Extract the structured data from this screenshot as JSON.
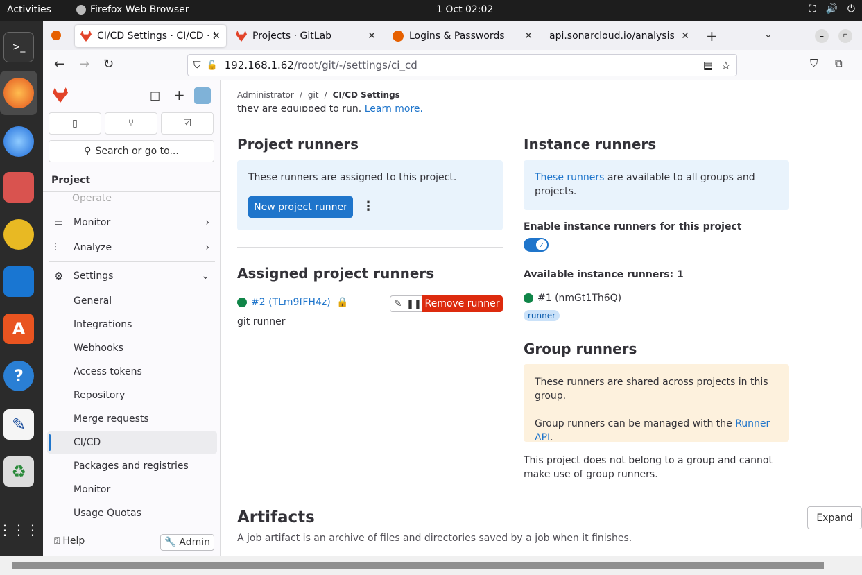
{
  "topbar": {
    "activities": "Activities",
    "app": "Firefox Web Browser",
    "clock": "1 Oct  02:02"
  },
  "tabs": [
    {
      "label": "CI/CD Settings · CI/CD · Se"
    },
    {
      "label": "Projects · GitLab"
    },
    {
      "label": "Logins & Passwords"
    },
    {
      "label": "api.sonarcloud.io/analysis/jr"
    }
  ],
  "url": {
    "host": "192.168.1.62",
    "path": "/root/git/-/settings/ci_cd"
  },
  "sidebar": {
    "search": "Search or go to...",
    "section": "Project",
    "operate": "Operate",
    "monitor": "Monitor",
    "analyze": "Analyze",
    "settings": "Settings",
    "subitems": [
      "General",
      "Integrations",
      "Webhooks",
      "Access tokens",
      "Repository",
      "Merge requests",
      "CI/CD",
      "Packages and registries",
      "Monitor",
      "Usage Quotas"
    ],
    "help": "Help",
    "admin": "Admin"
  },
  "breadcrumb": {
    "a": "Administrator",
    "b": "git",
    "c": "CI/CD Settings"
  },
  "main": {
    "cut_text": "they are equipped to run.",
    "cut_link": "Learn more.",
    "project_runners": "Project runners",
    "project_runners_info": "These runners are assigned to this project.",
    "new_runner": "New project runner",
    "assigned": "Assigned project runners",
    "runner_link": "#2 (TLm9fFH4z)",
    "runner_desc": "git runner",
    "remove": "Remove runner",
    "instance_runners": "Instance runners",
    "instance_link": "These runners",
    "instance_info": " are available to all groups and projects.",
    "enable_label": "Enable instance runners for this project",
    "available": "Available instance runners: 1",
    "instance_runner": "#1 (nmGt1Th6Q)",
    "runner_tag": "runner",
    "group_runners": "Group runners",
    "group_info1": "These runners are shared across projects in this group.",
    "group_info2a": "Group runners can be managed with the ",
    "group_info2_link": "Runner API",
    "group_info2b": ".",
    "group_note": "This project does not belong to a group and cannot make use of group runners.",
    "artifacts": "Artifacts",
    "artifacts_desc": "A job artifact is an archive of files and directories saved by a job when it finishes.",
    "expand": "Expand"
  },
  "colors": {
    "accent": "#1f75cb",
    "danger": "#dd2b0e",
    "success": "#108548"
  }
}
